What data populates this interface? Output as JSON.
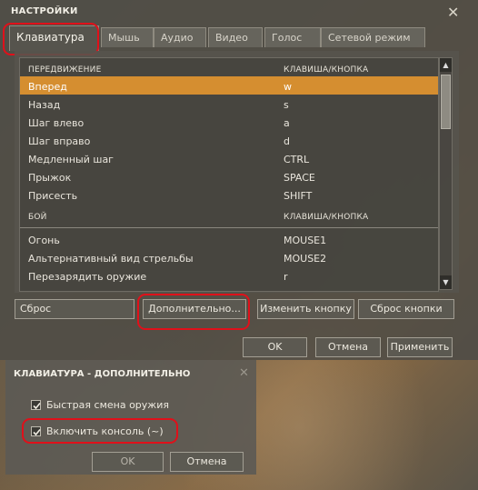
{
  "settings": {
    "title": "НАСТРОЙКИ",
    "close_glyph": "✕",
    "tabs": [
      "Клавиатура",
      "Мышь",
      "Аудио",
      "Видео",
      "Голос",
      "Сетевой режим"
    ],
    "active_tab": "Клавиатура",
    "sections": [
      {
        "header": "ПЕРЕДВИЖЕНИЕ",
        "column_header": "КЛАВИША/КНОПКА",
        "rows": [
          {
            "action": "Вперед",
            "key": "w",
            "selected": true
          },
          {
            "action": "Назад",
            "key": "s"
          },
          {
            "action": "Шаг влево",
            "key": "a"
          },
          {
            "action": "Шаг вправо",
            "key": "d"
          },
          {
            "action": "Медленный шаг",
            "key": "CTRL"
          },
          {
            "action": "Прыжок",
            "key": "SPACE"
          },
          {
            "action": "Присесть",
            "key": "SHIFT"
          }
        ]
      },
      {
        "header": "БОЙ",
        "column_header": "КЛАВИША/КНОПКА",
        "rows": [
          {
            "action": "Огонь",
            "key": "MOUSE1"
          },
          {
            "action": "Альтернативный вид стрельбы",
            "key": "MOUSE2"
          },
          {
            "action": "Перезарядить оружие",
            "key": "r"
          }
        ]
      }
    ],
    "scroll_up_glyph": "▲",
    "scroll_down_glyph": "▼",
    "buttons": {
      "reset": "Сброс",
      "advanced": "Дополнительно...",
      "change_key": "Изменить кнопку",
      "reset_key": "Сброс кнопки",
      "ok": "OK",
      "cancel": "Отмена",
      "apply": "Применить"
    },
    "colors": {
      "selection": "#d58e30",
      "highlight_outline": "#e0101a"
    }
  },
  "advanced": {
    "title": "КЛАВИАТУРА - ДОПОЛНИТЕЛЬНО",
    "close_glyph": "✕",
    "checkboxes": [
      {
        "label": "Быстрая смена оружия",
        "checked": true
      },
      {
        "label": "Включить консоль (~)",
        "checked": true
      }
    ],
    "buttons": {
      "ok": "OK",
      "cancel": "Отмена"
    }
  }
}
